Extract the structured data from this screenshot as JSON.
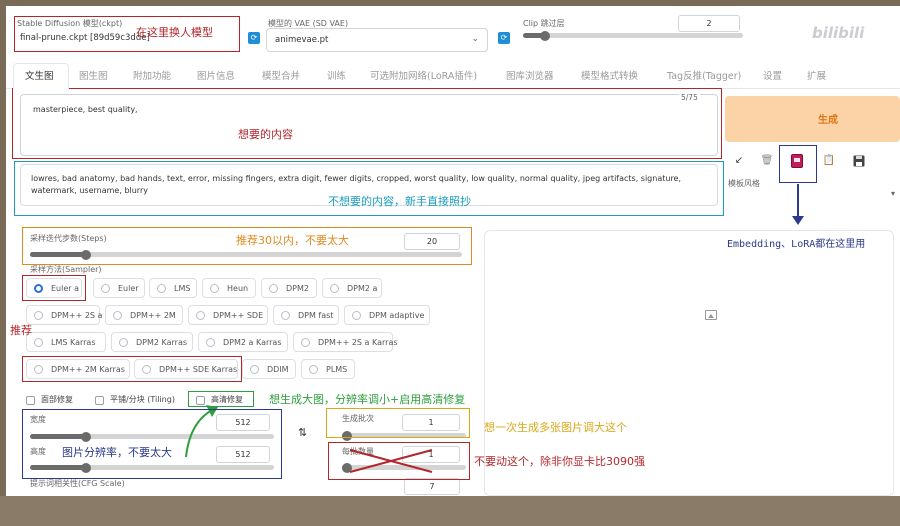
{
  "header": {
    "checkpoint_label": "Stable Diffusion 模型(ckpt)",
    "checkpoint_value": "final-prune.ckpt [89d59c3dde]",
    "vae_label": "模型的 VAE (SD VAE)",
    "vae_value": "animevae.pt",
    "clip_label": "Clip 跳过层",
    "clip_value": "2"
  },
  "tabs": [
    {
      "label": "文生图"
    },
    {
      "label": "图生图"
    },
    {
      "label": "附加功能"
    },
    {
      "label": "图片信息"
    },
    {
      "label": "模型合并"
    },
    {
      "label": "训练"
    },
    {
      "label": "可选附加网络(LoRA插件)"
    },
    {
      "label": "图库浏览器"
    },
    {
      "label": "模型格式转换"
    },
    {
      "label": "Tag反推(Tagger)"
    },
    {
      "label": "设置"
    },
    {
      "label": "扩展"
    }
  ],
  "prompt": {
    "positive": "masterpiece, best quality,",
    "counter": "5/75",
    "negative": "lowres, bad anatomy, bad hands, text, error, missing fingers, extra digit, fewer digits, cropped, worst quality, low quality, normal quality, jpeg artifacts, signature, watermark, username, blurry"
  },
  "generate": {
    "label": "生成",
    "style_label": "模板风格"
  },
  "steps": {
    "label": "采样迭代步数(Steps)",
    "value": "20",
    "fraction": 0.13
  },
  "sampler": {
    "label": "采样方法(Sampler)",
    "options": [
      "Euler a",
      "Euler",
      "LMS",
      "Heun",
      "DPM2",
      "DPM2 a",
      "DPM++ 2S a",
      "DPM++ 2M",
      "DPM++ SDE",
      "DPM fast",
      "DPM adaptive",
      "LMS Karras",
      "DPM2 Karras",
      "DPM2 a Karras",
      "DPM++ 2S a Karras",
      "DPM++ 2M Karras",
      "DPM++ SDE Karras",
      "DDIM",
      "PLMS"
    ],
    "selected": "Euler a"
  },
  "options": {
    "restore_faces": "面部修复",
    "tiling": "平铺/分块 (Tiling)",
    "hires_fix": "高清修复"
  },
  "size": {
    "width_label": "宽度",
    "width_value": "512",
    "height_label": "高度",
    "height_value": "512",
    "fraction": 0.23
  },
  "batch": {
    "count_label": "生成批次",
    "count_value": "1",
    "size_label": "每批数量",
    "size_value": "1",
    "fraction": 0.0
  },
  "cfg": {
    "label": "提示词相关性(CFG Scale)",
    "value": "7"
  },
  "annotations": {
    "model": "在这里换人模型",
    "wanted": "想要的内容",
    "unwanted": "不想要的内容，新手直接照抄",
    "steps_tip": "推荐30以内，不要太大",
    "recommend": "推荐",
    "embedding": "Embedding、LoRA都在这里用",
    "hires_tip": "想生成大图，分辨率调小+启用高清修复",
    "batch_tip": "想一次生成多张图片调大这个",
    "size_tip": "图片分辨率，不要太大",
    "batchsize_tip": "不要动这个，除非你显卡比3090强"
  },
  "watermark": "bilibili",
  "colors": {
    "accent_blue": "#2b6fde",
    "generate_bg": "#fbd3a6",
    "generate_text": "#e07812",
    "annotation_red": "#b3262b",
    "annotation_orange": "#e0891e",
    "annotation_teal": "#1a9dbf",
    "annotation_navy": "#2b3a8c",
    "annotation_green": "#2e9e3e",
    "annotation_yellow": "#d9a818"
  }
}
